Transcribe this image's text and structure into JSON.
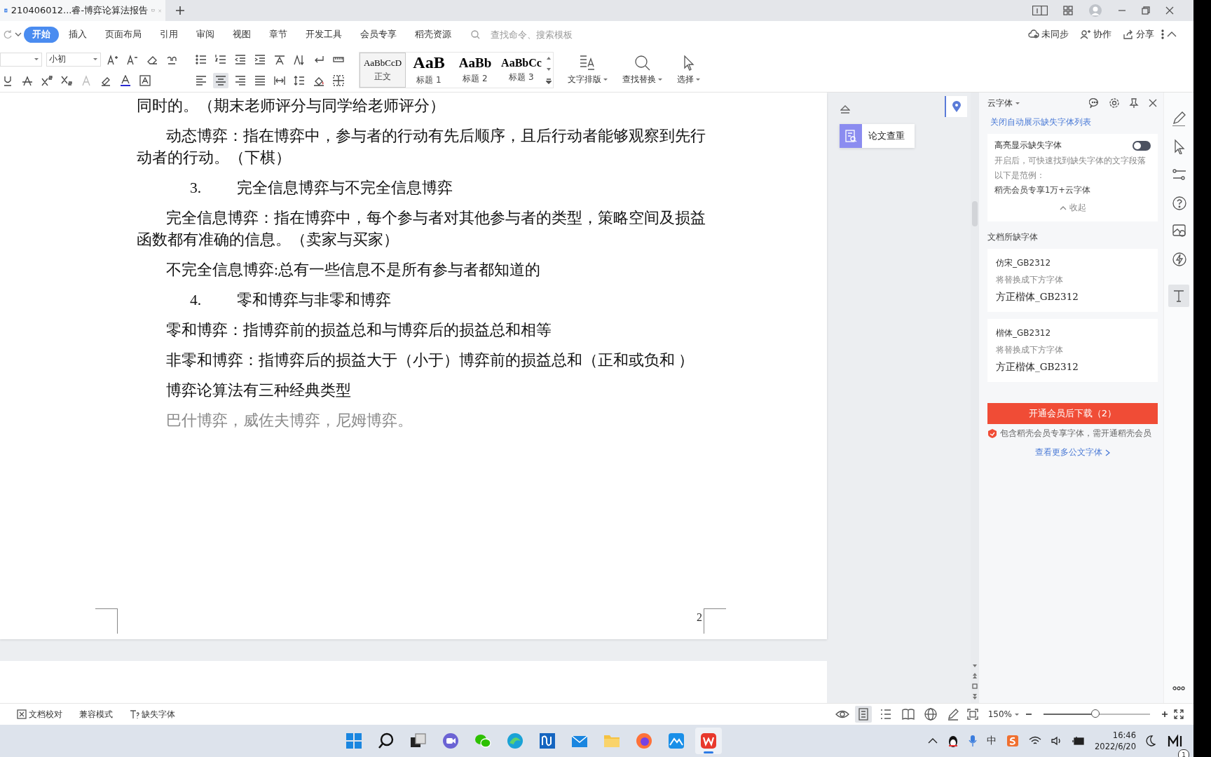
{
  "window": {
    "tab_title": "210406012...睿-博弈论算法报告"
  },
  "menu": {
    "tabs": [
      {
        "label": "开始",
        "selected": true
      },
      {
        "label": "插入",
        "selected": false
      },
      {
        "label": "页面布局",
        "selected": false
      },
      {
        "label": "引用",
        "selected": false
      },
      {
        "label": "审阅",
        "selected": false
      },
      {
        "label": "视图",
        "selected": false
      },
      {
        "label": "章节",
        "selected": false
      },
      {
        "label": "开发工具",
        "selected": false
      },
      {
        "label": "会员专享",
        "selected": false
      },
      {
        "label": "稻壳资源",
        "selected": false
      }
    ],
    "search": {
      "placeholder": "查找命令、搜索模板"
    },
    "actions": [
      {
        "label": "未同步"
      },
      {
        "label": "协作"
      },
      {
        "label": "分享"
      }
    ]
  },
  "toolbar": {
    "font_size": "小初",
    "alignment": [
      {
        "selected": false
      },
      {
        "selected": true
      },
      {
        "selected": false
      },
      {
        "selected": false
      },
      {
        "selected": false
      }
    ],
    "styles": [
      {
        "preview": "AaBbCcD",
        "label": "正文",
        "selected": true
      },
      {
        "preview": "AaB",
        "label": "标题 1",
        "selected": false
      },
      {
        "preview": "AaBb",
        "label": "标题 2",
        "selected": false
      },
      {
        "preview": "AaBbCc",
        "label": "标题 3",
        "selected": false
      }
    ],
    "tools": [
      {
        "label": "文字排版"
      },
      {
        "label": "查找替换"
      },
      {
        "label": "选择"
      }
    ]
  },
  "document": {
    "paragraphs": [
      {
        "kind": "body",
        "indent": false,
        "text": "同时的。（期末老师评分与同学给老师评分）"
      },
      {
        "kind": "body",
        "indent": true,
        "text": "动态博弈：指在博弈中，参与者的行动有先后顺序，且后行动者能够观察到先行动者的行动。（下棋）"
      },
      {
        "kind": "heading",
        "number": "3.",
        "text": "完全信息博弈与不完全信息博弈"
      },
      {
        "kind": "body",
        "indent": true,
        "text": "完全信息博弈：指在博弈中，每个参与者对其他参与者的类型，策略空间及损益函数都有准确的信息。（卖家与买家）"
      },
      {
        "kind": "body",
        "indent": true,
        "text": "不完全信息博弈:总有一些信息不是所有参与者都知道的"
      },
      {
        "kind": "heading",
        "number": "4.",
        "text": "零和博弈与非零和博弈"
      },
      {
        "kind": "body",
        "indent": true,
        "text": "零和博弈：指博弈前的损益总和与博弈后的损益总和相等"
      },
      {
        "kind": "body",
        "indent": true,
        "text": "非零和博弈：指博弈后的损益大于（小于）博弈前的损益总和（正和或负和 ）"
      },
      {
        "kind": "body",
        "indent": true,
        "text": "博弈论算法有三种经典类型"
      },
      {
        "kind": "faded",
        "indent": true,
        "text": "巴什博弈，威佐夫博弈，尼姆博弈。"
      }
    ],
    "page_number": "2"
  },
  "side_tool": {
    "label": "论文查重"
  },
  "font_panel": {
    "title": "云字体",
    "link": "关闭自动展示缺失字体列表",
    "highlight": {
      "label": "高亮显示缺失字体",
      "on": false,
      "description": "开启后，可快速找到缺失字体的文字段落",
      "example_label": "以下是范例：",
      "example": "稻壳会员专享1万+云字体",
      "collapse": "收起"
    },
    "missing_heading": "文档所缺字体",
    "missing_fonts": [
      {
        "name": "仿宋_GB2312",
        "hint": "将替换成下方字体",
        "replacement": "方正楷体_GB2312"
      },
      {
        "name": "楷体_GB2312",
        "hint": "将替换成下方字体",
        "replacement": "方正楷体_GB2312"
      }
    ],
    "download_button": "开通会员后下载（2）",
    "notice": "包含稻壳会员专享字体，需开通稻壳会员",
    "more_link": "查看更多公文字体"
  },
  "status_bar": {
    "items": [
      {
        "label": "文档校对"
      },
      {
        "label": "兼容模式"
      },
      {
        "label": "缺失字体"
      }
    ],
    "views": [
      {
        "selected": true
      },
      {
        "selected": false
      },
      {
        "selected": false
      },
      {
        "selected": false
      },
      {
        "selected": false
      }
    ],
    "zoom": {
      "value": "150%",
      "level": 0.49
    }
  },
  "taskbar": {
    "apps": [
      {
        "active": false
      },
      {
        "active": false
      },
      {
        "active": false
      },
      {
        "active": false
      },
      {
        "active": false
      },
      {
        "active": false
      },
      {
        "active": false
      },
      {
        "active": false
      },
      {
        "active": false
      },
      {
        "active": false
      },
      {
        "active": false
      },
      {
        "active": true
      }
    ],
    "ime": "中",
    "time": "16:46",
    "date": "2022/6/20",
    "badge": "1"
  }
}
